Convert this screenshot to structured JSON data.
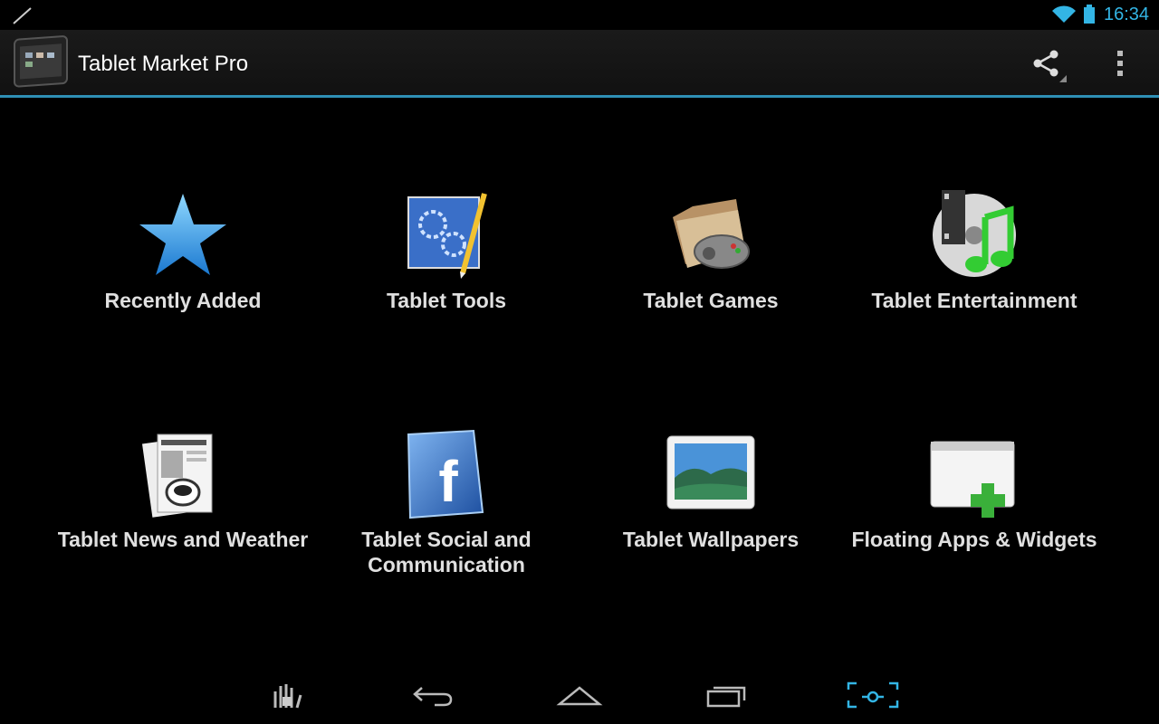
{
  "status_bar": {
    "time": "16:34",
    "icons": [
      "pen-icon",
      "wifi-icon",
      "battery-icon"
    ],
    "accent_color": "#33b5e5"
  },
  "action_bar": {
    "title": "Tablet Market Pro",
    "app_icon": "tablet-icon",
    "actions": [
      "share-icon",
      "overflow-menu-icon"
    ],
    "divider_color": "#2f8fb5"
  },
  "categories": [
    {
      "label": "Recently Added",
      "icon": "star-icon"
    },
    {
      "label": "Tablet Tools",
      "icon": "blueprint-gears-icon"
    },
    {
      "label": "Tablet Games",
      "icon": "folder-gamepad-icon"
    },
    {
      "label": "Tablet Entertainment",
      "icon": "music-cd-icon"
    },
    {
      "label": "Tablet News and Weather",
      "icon": "newspaper-icon"
    },
    {
      "label": "Tablet Social and Communication",
      "icon": "facebook-icon"
    },
    {
      "label": "Tablet Wallpapers",
      "icon": "landscape-picture-icon"
    },
    {
      "label": "Floating Apps & Widgets",
      "icon": "window-add-icon"
    }
  ],
  "nav_bar": {
    "buttons": [
      "gesture-lock-icon",
      "back-icon",
      "home-icon",
      "recent-apps-icon",
      "screenshot-icon"
    ]
  }
}
